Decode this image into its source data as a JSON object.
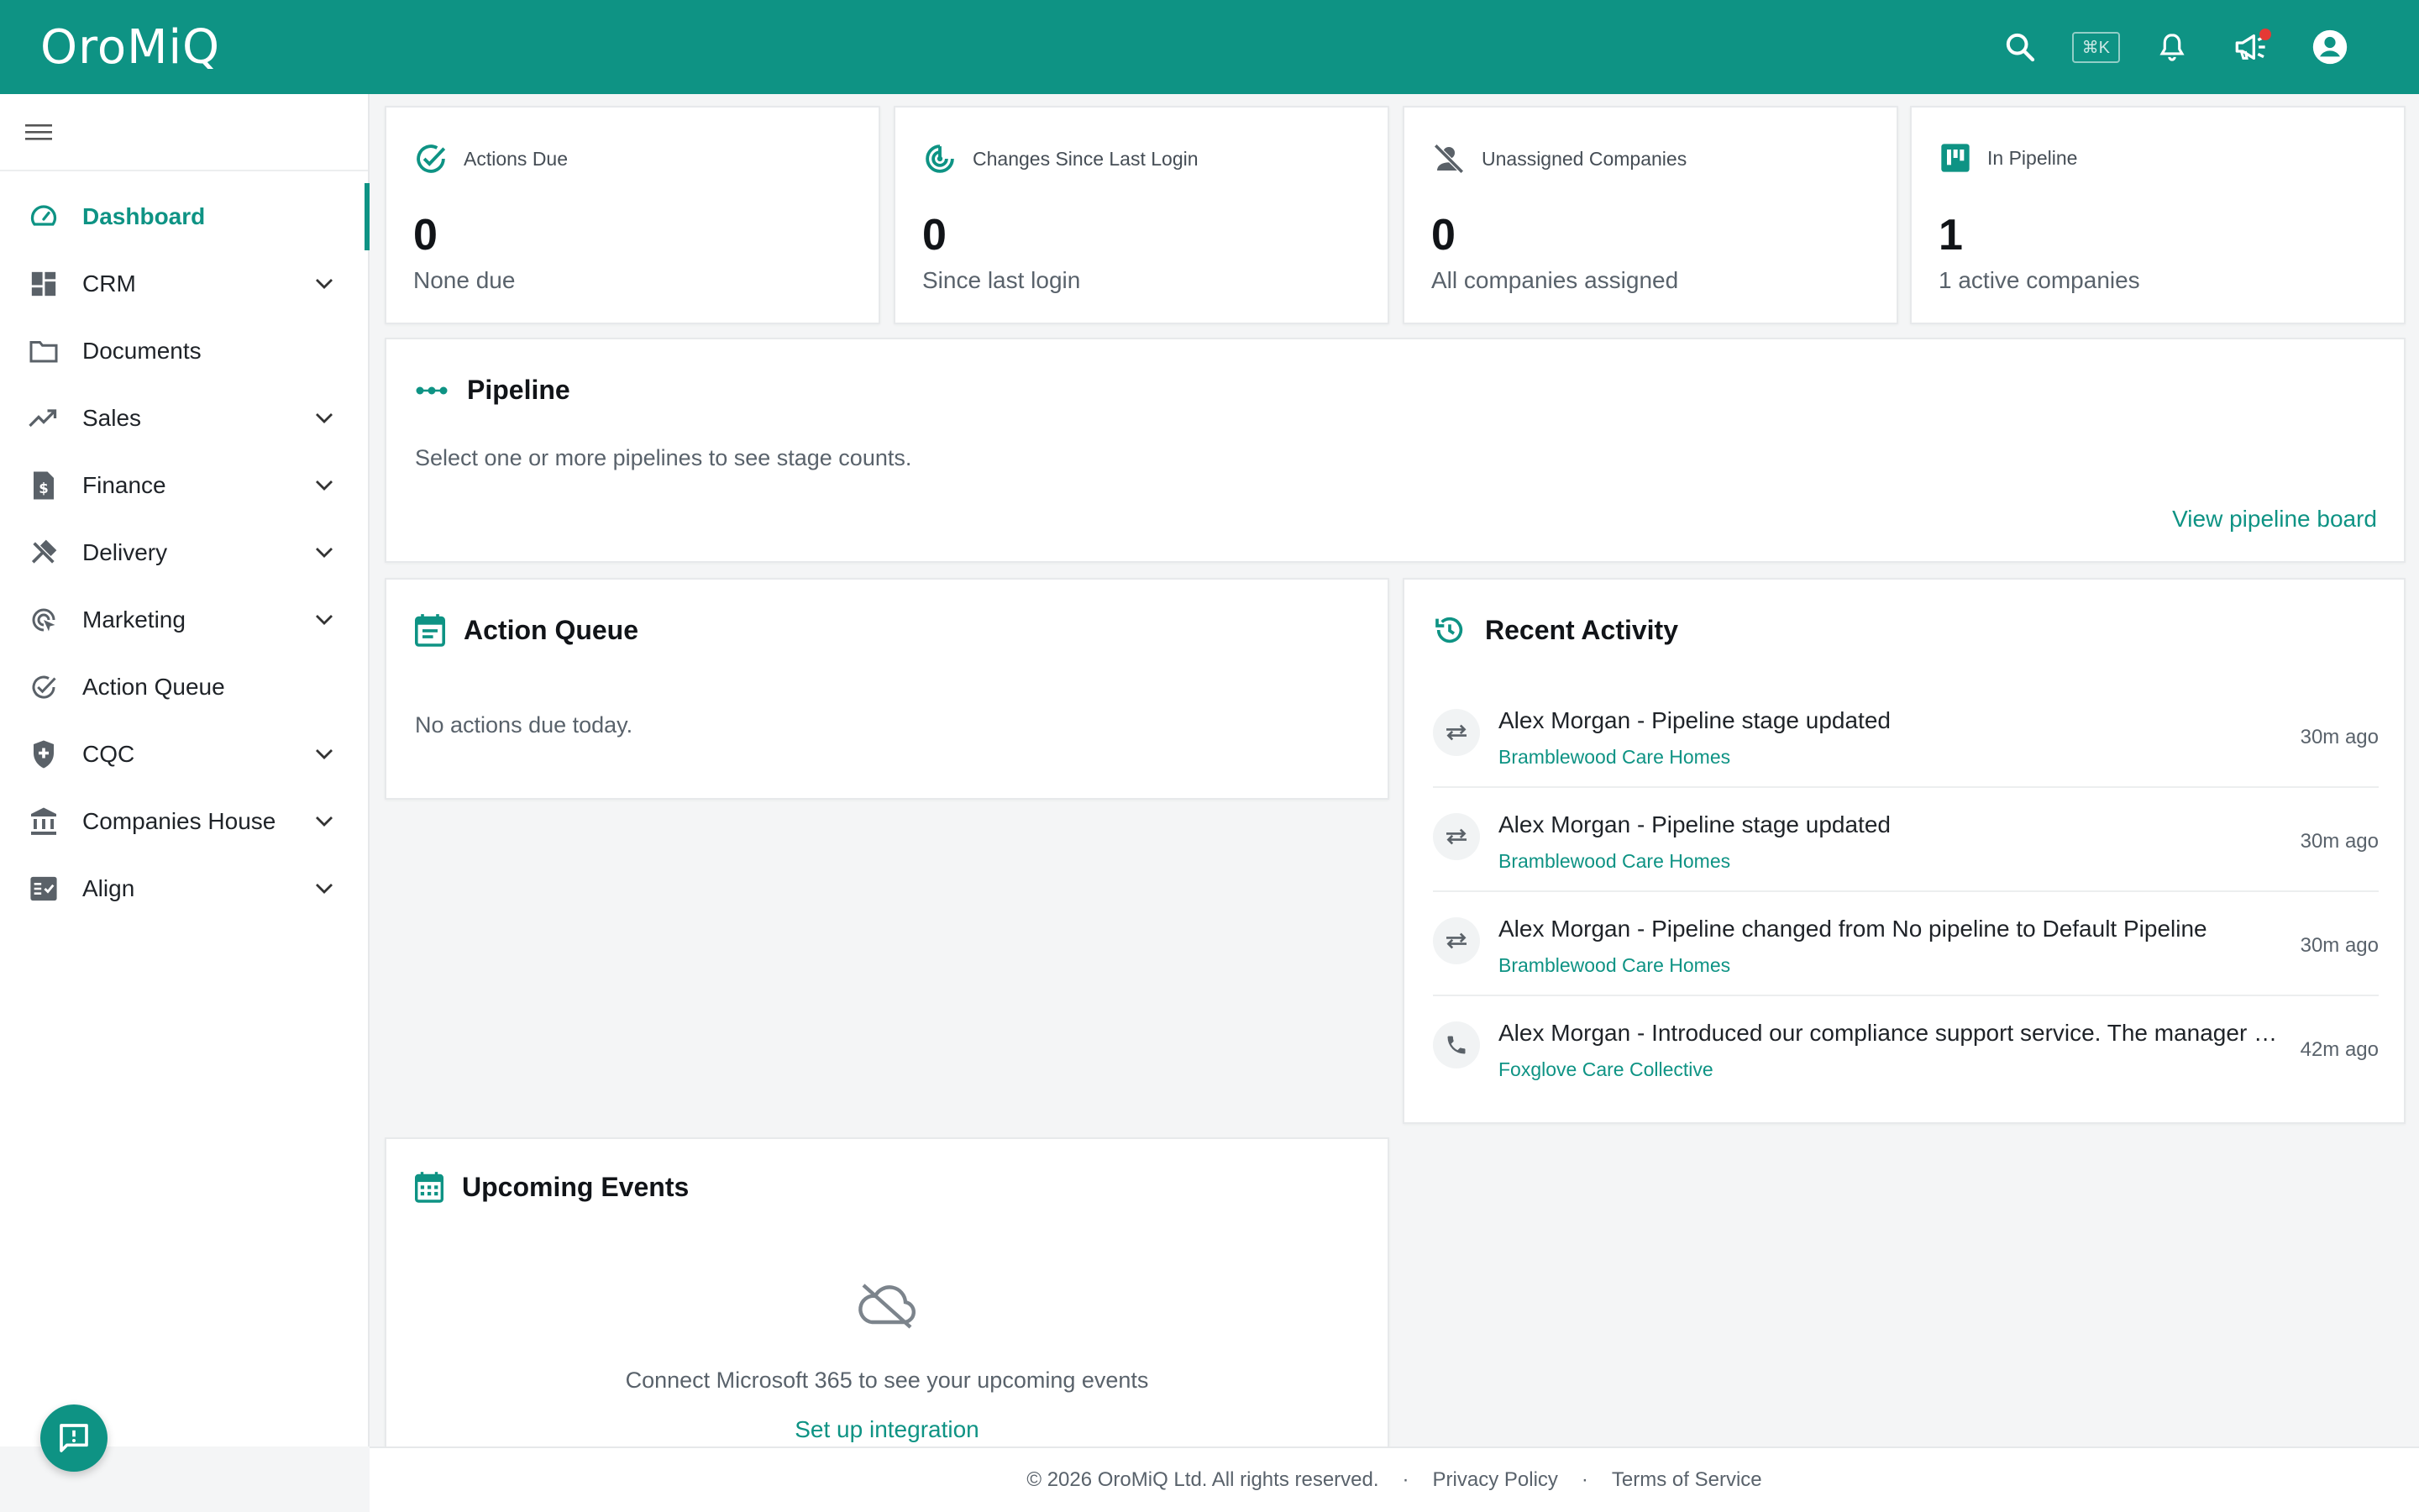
{
  "app": {
    "logo": "OroMiQ",
    "shortcut": "⌘K"
  },
  "header_icons": [
    "search-icon",
    "bell-icon",
    "megaphone-icon",
    "account-circle-icon"
  ],
  "sidebar": {
    "items": [
      {
        "label": "Dashboard",
        "icon": "dashboard-gauge-icon",
        "active": true,
        "expandable": false
      },
      {
        "label": "CRM",
        "icon": "grid-icon",
        "expandable": true
      },
      {
        "label": "Documents",
        "icon": "folder-icon",
        "expandable": false
      },
      {
        "label": "Sales",
        "icon": "trending-up-icon",
        "expandable": true
      },
      {
        "label": "Finance",
        "icon": "invoice-icon",
        "expandable": true
      },
      {
        "label": "Delivery",
        "icon": "tools-icon",
        "expandable": true
      },
      {
        "label": "Marketing",
        "icon": "target-cursor-icon",
        "expandable": true
      },
      {
        "label": "Action Queue",
        "icon": "check-circle-icon",
        "expandable": false
      },
      {
        "label": "CQC",
        "icon": "shield-plus-icon",
        "expandable": true
      },
      {
        "label": "Companies House",
        "icon": "bank-icon",
        "expandable": true
      },
      {
        "label": "Align",
        "icon": "checklist-icon",
        "expandable": true
      }
    ]
  },
  "stats": [
    {
      "title": "Actions Due",
      "value": "0",
      "sub": "None due",
      "icon": "check-circle-icon"
    },
    {
      "title": "Changes Since Last Login",
      "value": "0",
      "sub": "Since last login",
      "icon": "radar-icon"
    },
    {
      "title": "Unassigned Companies",
      "value": "0",
      "sub": "All companies assigned",
      "icon": "person-off-icon"
    },
    {
      "title": "In Pipeline",
      "value": "1",
      "sub": "1 active companies",
      "icon": "kanban-icon"
    }
  ],
  "pipeline": {
    "title": "Pipeline",
    "message": "Select one or more pipelines to see stage counts.",
    "link": "View pipeline board"
  },
  "action_queue": {
    "title": "Action Queue",
    "message": "No actions due today."
  },
  "recent_activity": {
    "title": "Recent Activity",
    "items": [
      {
        "title": "Alex Morgan - Pipeline stage updated",
        "company": "Bramblewood Care Homes",
        "time": "30m ago",
        "icon": "swap-icon"
      },
      {
        "title": "Alex Morgan - Pipeline stage updated",
        "company": "Bramblewood Care Homes",
        "time": "30m ago",
        "icon": "swap-icon"
      },
      {
        "title": "Alex Morgan - Pipeline changed from No pipeline to Default Pipeline",
        "company": "Bramblewood Care Homes",
        "time": "30m ago",
        "icon": "swap-icon"
      },
      {
        "title": "Alex Morgan - Introduced our compliance support service. The manager was interested in a follow-up call",
        "company": "Foxglove Care Collective",
        "time": "42m ago",
        "icon": "phone-icon"
      }
    ]
  },
  "upcoming_events": {
    "title": "Upcoming Events",
    "message": "Connect Microsoft 365 to see your upcoming events",
    "link": "Set up integration"
  },
  "footer": {
    "copyright": "© 2026 OroMiQ Ltd. All rights reserved.",
    "separator": "·",
    "privacy": "Privacy Policy",
    "terms": "Terms of Service"
  },
  "colors": {
    "brand": "#0e9384",
    "alert_dot": "#e53935"
  }
}
